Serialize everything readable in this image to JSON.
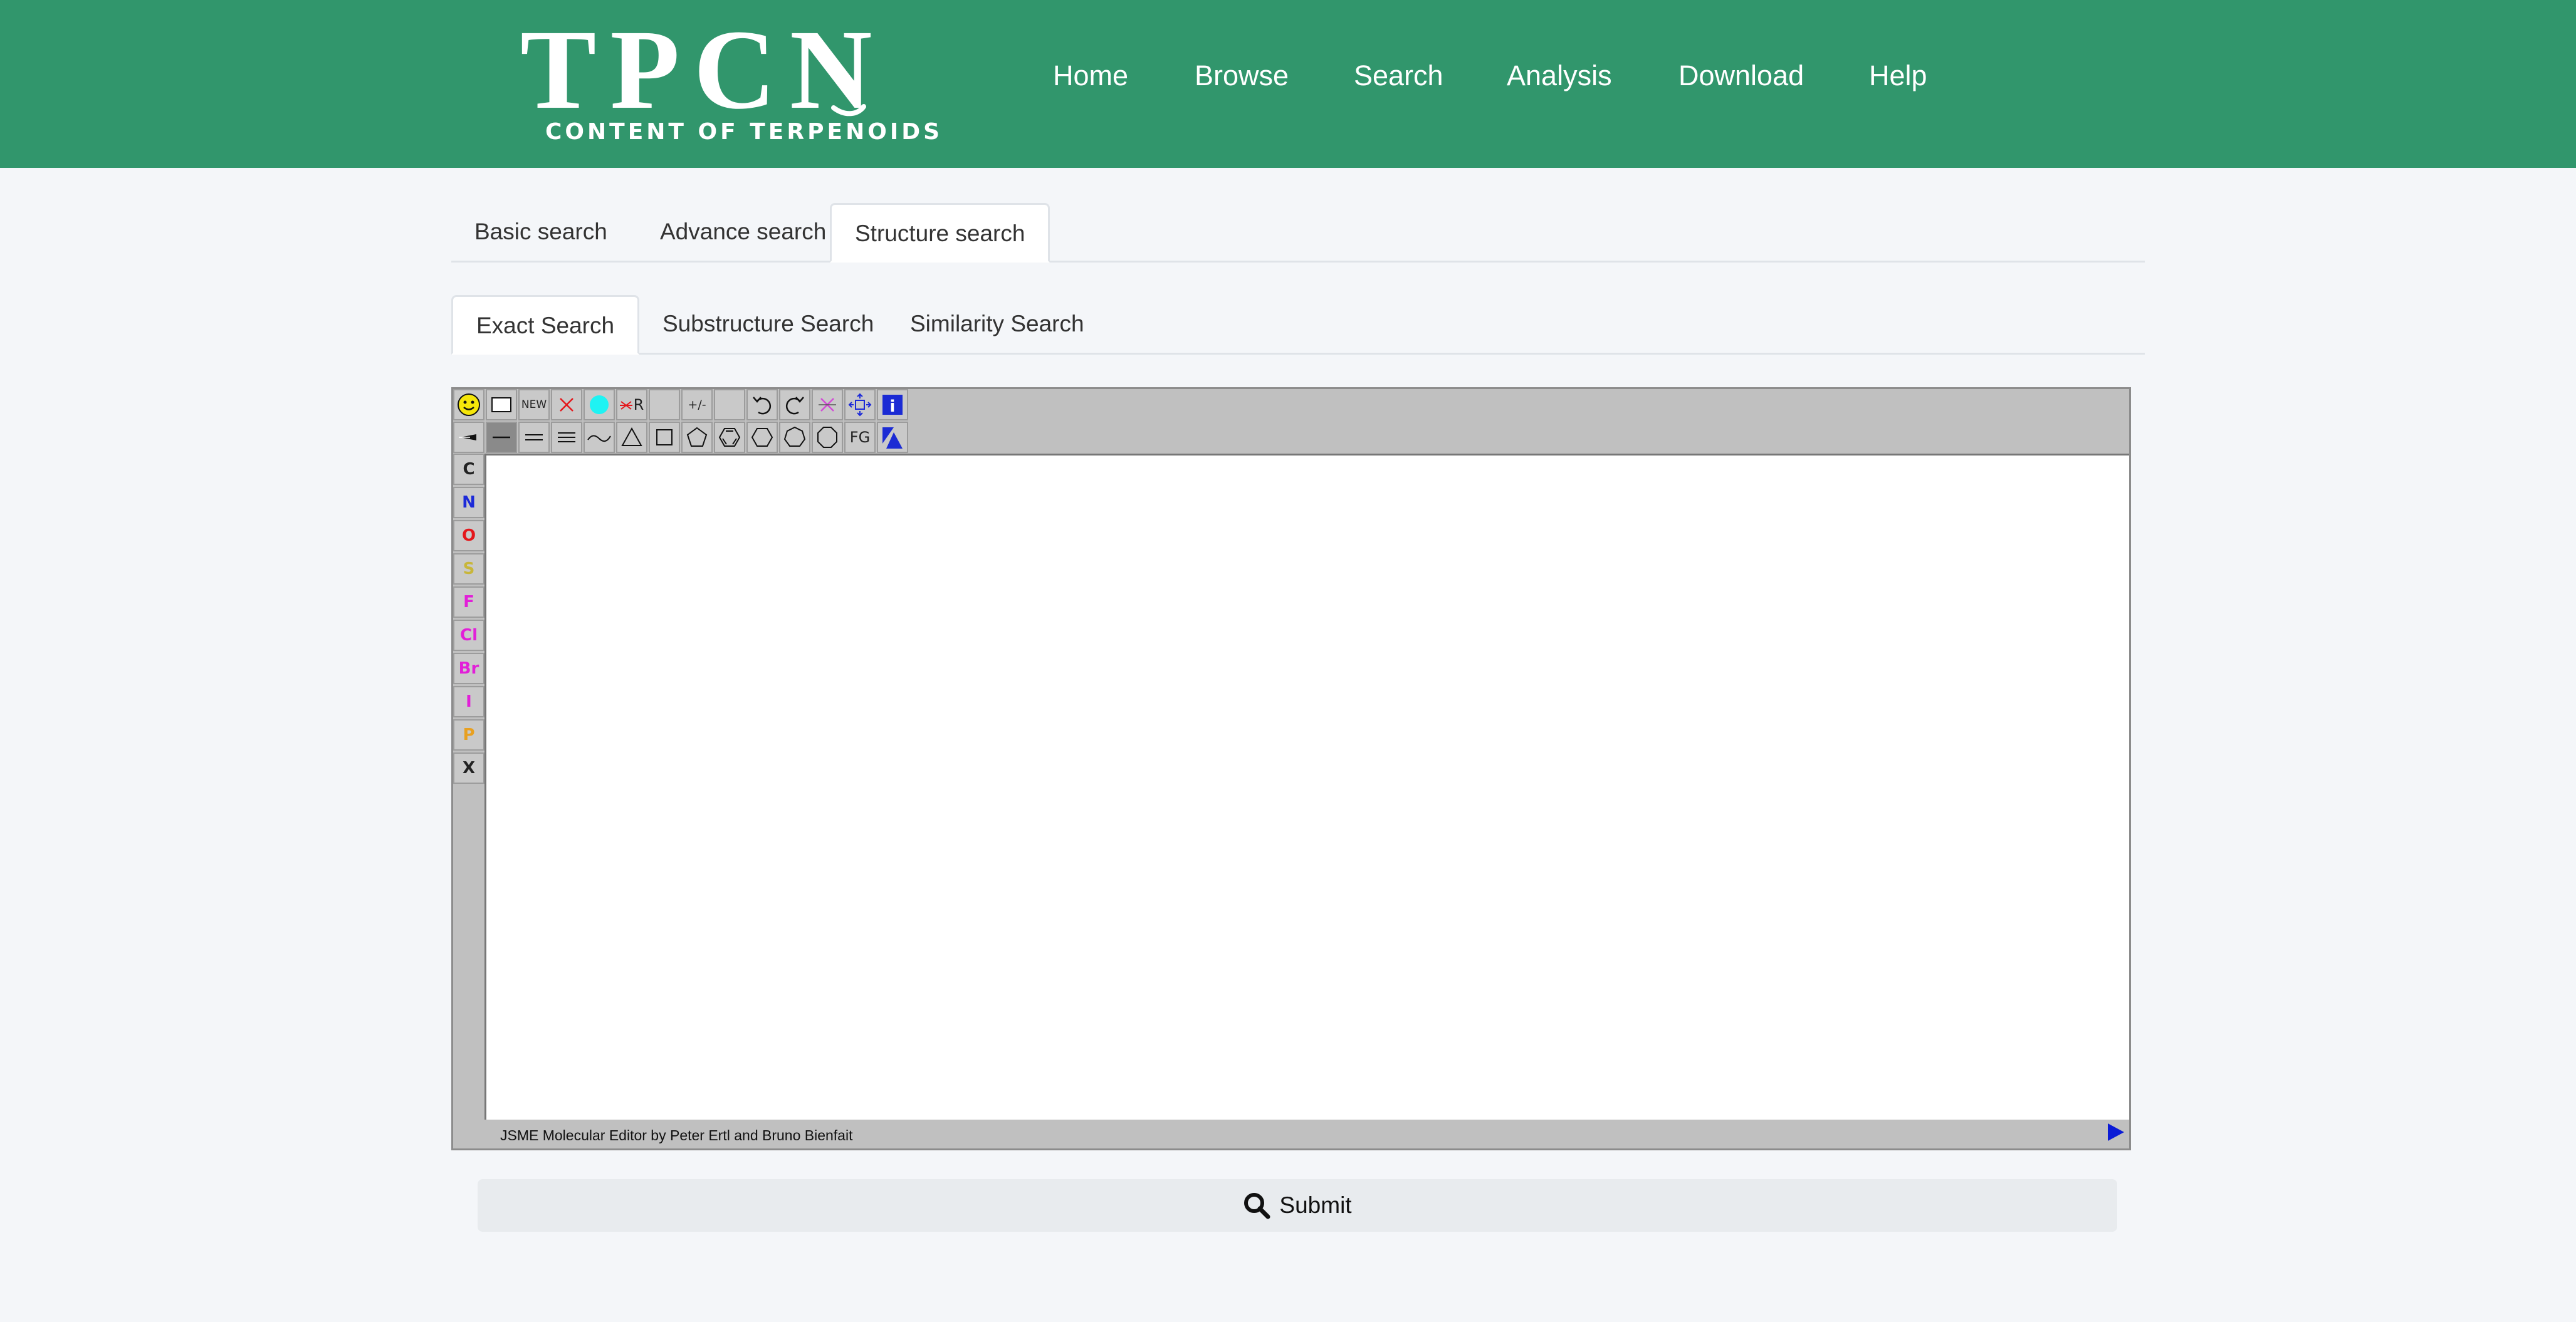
{
  "logo": {
    "title": "TPCN",
    "subtitle": "CONTENT OF TERPENOIDS"
  },
  "nav": [
    "Home",
    "Browse",
    "Search",
    "Analysis",
    "Download",
    "Help"
  ],
  "search_tabs": {
    "items": [
      "Basic search",
      "Advance search",
      "Structure search"
    ],
    "active": "Structure search"
  },
  "structure_tabs": {
    "items": [
      "Exact Search",
      "Substructure Search",
      "Similarity Search"
    ],
    "active": "Exact Search"
  },
  "editor": {
    "toolbar_row1": [
      {
        "name": "smiley-icon"
      },
      {
        "name": "smiles-box-icon"
      },
      {
        "name": "new-button",
        "label": "NEW"
      },
      {
        "name": "delete-icon"
      },
      {
        "name": "mark-atom-icon"
      },
      {
        "name": "delete-group-icon",
        "label": "R"
      },
      {
        "name": "blank-1"
      },
      {
        "name": "charge-icon",
        "label": "+/-"
      },
      {
        "name": "blank-2"
      },
      {
        "name": "undo-icon"
      },
      {
        "name": "redo-icon"
      },
      {
        "name": "clear-icon"
      },
      {
        "name": "move-icon"
      },
      {
        "name": "info-icon",
        "label": "i"
      }
    ],
    "toolbar_row2": [
      {
        "name": "stereo-bond-icon"
      },
      {
        "name": "single-bond-icon"
      },
      {
        "name": "double-bond-icon"
      },
      {
        "name": "triple-bond-icon"
      },
      {
        "name": "chain-icon"
      },
      {
        "name": "ring-3-icon"
      },
      {
        "name": "ring-4-icon"
      },
      {
        "name": "ring-5-icon"
      },
      {
        "name": "benzene-icon"
      },
      {
        "name": "ring-6-icon"
      },
      {
        "name": "ring-7-icon"
      },
      {
        "name": "ring-8-icon"
      },
      {
        "name": "functional-group-button",
        "label": "FG"
      },
      {
        "name": "expand-icon"
      }
    ],
    "atoms": [
      {
        "symbol": "C",
        "color": "#111111"
      },
      {
        "symbol": "N",
        "color": "#1c2ad8"
      },
      {
        "symbol": "O",
        "color": "#e4171b"
      },
      {
        "symbol": "S",
        "color": "#c8b63a"
      },
      {
        "symbol": "F",
        "color": "#e21fd8"
      },
      {
        "symbol": "Cl",
        "color": "#e21fd8"
      },
      {
        "symbol": "Br",
        "color": "#e21fd8"
      },
      {
        "symbol": "I",
        "color": "#e21fd8"
      },
      {
        "symbol": "P",
        "color": "#e8a020"
      },
      {
        "symbol": "X",
        "color": "#111111"
      }
    ],
    "status": "JSME Molecular Editor by Peter Ertl and Bruno Bienfait"
  },
  "submit": {
    "label": "Submit"
  },
  "colors": {
    "header": "#31966c",
    "page": "#f4f6f9",
    "editor_frame": "#c0c0c0"
  }
}
